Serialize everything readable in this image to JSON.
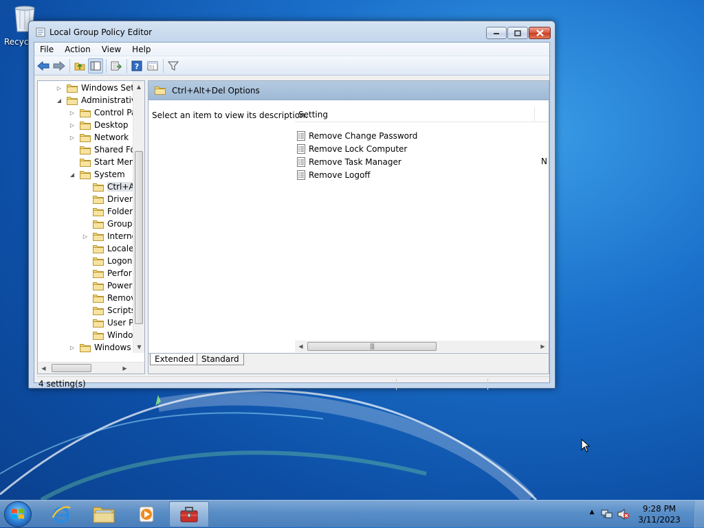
{
  "desktop": {
    "recycle_bin_label": "Recyc"
  },
  "window": {
    "title": "Local Group Policy Editor",
    "menu": [
      "File",
      "Action",
      "View",
      "Help"
    ],
    "tree": [
      {
        "label": "Windows Sett",
        "level": 1,
        "expander": "closed"
      },
      {
        "label": "Administrative",
        "level": 1,
        "expander": "open"
      },
      {
        "label": "Control Pa",
        "level": 2,
        "expander": "closed"
      },
      {
        "label": "Desktop",
        "level": 2,
        "expander": "closed"
      },
      {
        "label": "Network",
        "level": 2,
        "expander": "closed"
      },
      {
        "label": "Shared Fol",
        "level": 2,
        "expander": "none"
      },
      {
        "label": "Start Menu",
        "level": 2,
        "expander": "none"
      },
      {
        "label": "System",
        "level": 2,
        "expander": "open"
      },
      {
        "label": "Ctrl+A",
        "level": 3,
        "expander": "none",
        "selected": true
      },
      {
        "label": "Driver",
        "level": 3,
        "expander": "none"
      },
      {
        "label": "Folder",
        "level": 3,
        "expander": "none"
      },
      {
        "label": "Group",
        "level": 3,
        "expander": "none"
      },
      {
        "label": "Interne",
        "level": 3,
        "expander": "closed"
      },
      {
        "label": "Locale",
        "level": 3,
        "expander": "none"
      },
      {
        "label": "Logon",
        "level": 3,
        "expander": "none"
      },
      {
        "label": "Perfor",
        "level": 3,
        "expander": "none"
      },
      {
        "label": "Power",
        "level": 3,
        "expander": "none"
      },
      {
        "label": "Remov",
        "level": 3,
        "expander": "none"
      },
      {
        "label": "Scripts",
        "level": 3,
        "expander": "none"
      },
      {
        "label": "User Pr",
        "level": 3,
        "expander": "none"
      },
      {
        "label": "Windo",
        "level": 3,
        "expander": "none"
      },
      {
        "label": "Windows",
        "level": 2,
        "expander": "closed"
      }
    ],
    "header_title": "Ctrl+Alt+Del Options",
    "description_hint": "Select an item to view its description.",
    "list_column_setting": "Setting",
    "settings": [
      {
        "name": "Remove Change Password",
        "state": ""
      },
      {
        "name": "Remove Lock Computer",
        "state": ""
      },
      {
        "name": "Remove Task Manager",
        "state": "N"
      },
      {
        "name": "Remove Logoff",
        "state": ""
      }
    ],
    "tabs": [
      "Extended",
      "Standard"
    ],
    "status_text": "4 setting(s)"
  },
  "taskbar": {
    "time": "9:28 PM",
    "date": "3/11/2023"
  },
  "colors": {
    "accent": "#1a6fc9",
    "header_band": "#a9c2dc"
  }
}
